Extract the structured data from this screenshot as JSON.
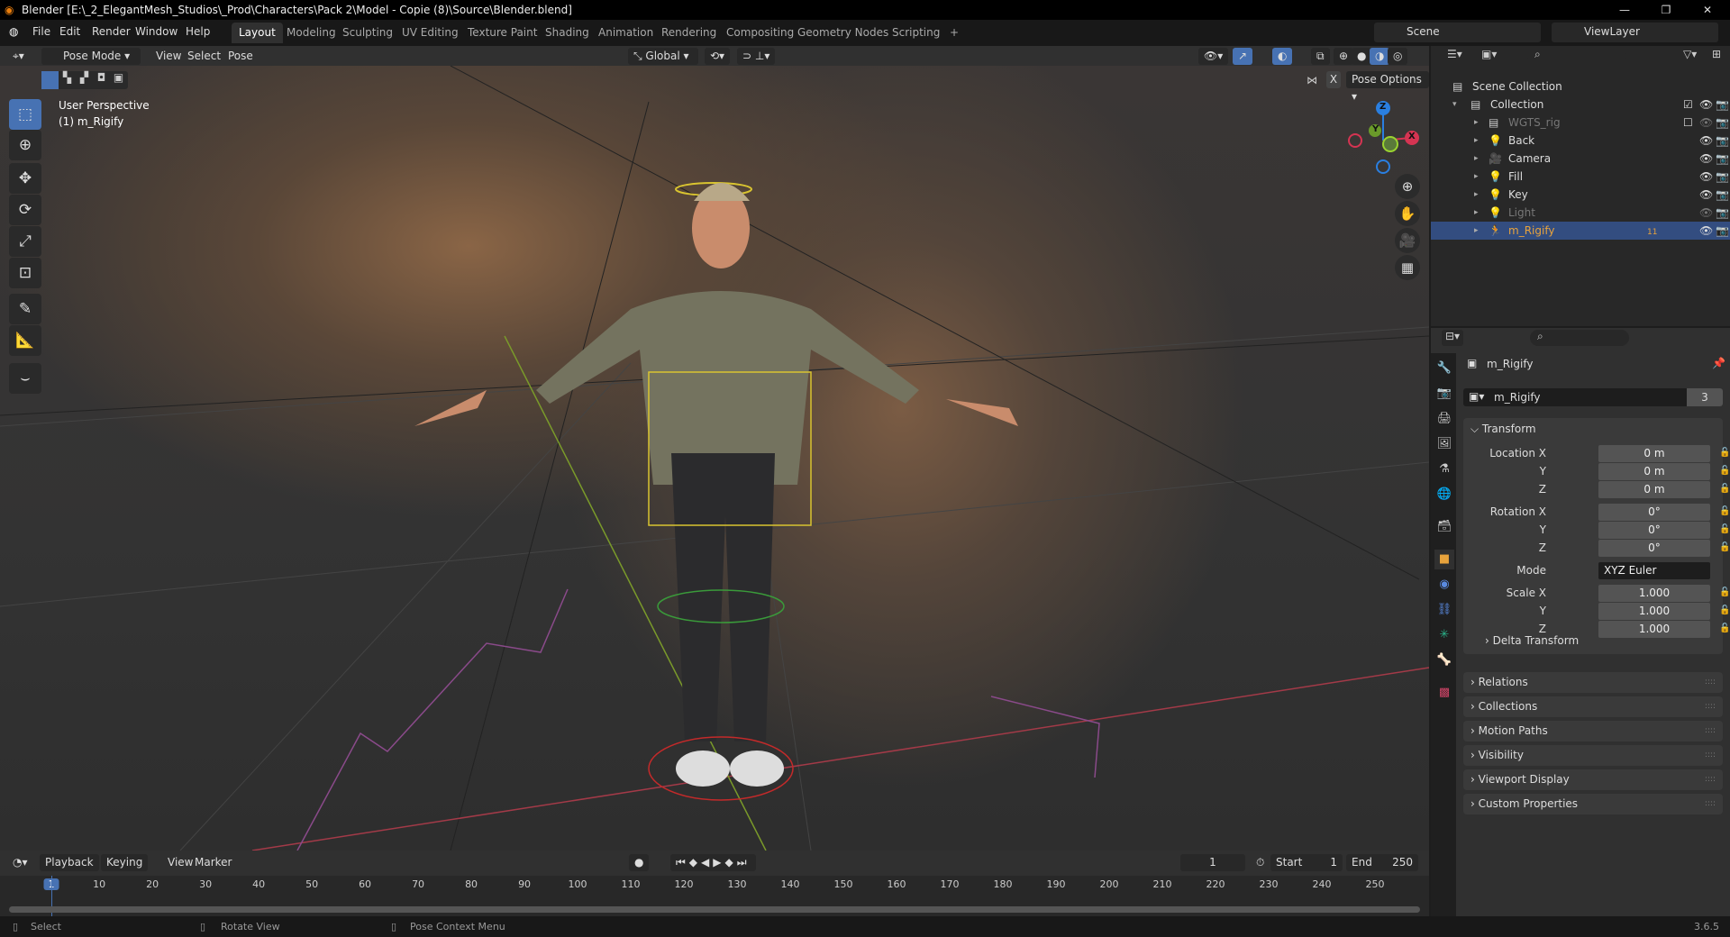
{
  "title": "Blender [E:\\_2_ElegantMesh_Studios\\_Prod\\Characters\\Pack 2\\Model - Copie (8)\\Source\\Blender.blend]",
  "menu": [
    "File",
    "Edit",
    "Render",
    "Window",
    "Help"
  ],
  "workspaces": [
    "Layout",
    "Modeling",
    "Sculpting",
    "UV Editing",
    "Texture Paint",
    "Shading",
    "Animation",
    "Rendering",
    "Compositing",
    "Geometry Nodes",
    "Scripting",
    "+"
  ],
  "scene": "Scene",
  "view_layer": "ViewLayer",
  "viewport": {
    "mode": "Pose Mode",
    "menus": [
      "View",
      "Select",
      "Pose"
    ],
    "orientation": "Global",
    "pose_options": "Pose Options",
    "mirror_x": "X",
    "overlay_title": "User Perspective",
    "overlay_object": "(1) m_Rigify",
    "gizmo": {
      "z": "Z",
      "y": "Y",
      "x": "X"
    }
  },
  "outliner": {
    "items": [
      {
        "name": "Scene Collection",
        "indent": 0,
        "icon": "collection"
      },
      {
        "name": "Collection",
        "indent": 1,
        "icon": "collection"
      },
      {
        "name": "WGTS_rig",
        "indent": 2,
        "icon": "collection",
        "dim": true
      },
      {
        "name": "Back",
        "indent": 2,
        "icon": "light"
      },
      {
        "name": "Camera",
        "indent": 2,
        "icon": "camera"
      },
      {
        "name": "Fill",
        "indent": 2,
        "icon": "light"
      },
      {
        "name": "Key",
        "indent": 2,
        "icon": "light"
      },
      {
        "name": "Light",
        "indent": 2,
        "icon": "light",
        "dim": true
      },
      {
        "name": "m_Rigify",
        "indent": 2,
        "icon": "armature",
        "selected": true
      }
    ],
    "badge": "11"
  },
  "properties": {
    "object_name": "m_Rigify",
    "data_name": "m_Rigify",
    "users": "3",
    "transform": "Transform",
    "rows": [
      {
        "label": "Location X",
        "value": "0 m"
      },
      {
        "label": "Y",
        "value": "0 m"
      },
      {
        "label": "Z",
        "value": "0 m"
      },
      {
        "label": "Rotation X",
        "value": "0°"
      },
      {
        "label": "Y",
        "value": "0°"
      },
      {
        "label": "Z",
        "value": "0°"
      },
      {
        "label": "Mode",
        "value": "XYZ Euler"
      },
      {
        "label": "Scale X",
        "value": "1.000"
      },
      {
        "label": "Y",
        "value": "1.000"
      },
      {
        "label": "Z",
        "value": "1.000"
      }
    ],
    "delta": "Delta Transform",
    "panels": [
      "Relations",
      "Collections",
      "Motion Paths",
      "Visibility",
      "Viewport Display",
      "Custom Properties"
    ]
  },
  "timeline": {
    "menus": [
      "Playback",
      "Keying",
      "View",
      "Marker"
    ],
    "current_frame": "1",
    "start_label": "Start",
    "start": "1",
    "end_label": "End",
    "end": "250",
    "ticks": [
      "1",
      "10",
      "20",
      "30",
      "40",
      "50",
      "60",
      "70",
      "80",
      "90",
      "100",
      "110",
      "120",
      "130",
      "140",
      "150",
      "160",
      "170",
      "180",
      "190",
      "200",
      "210",
      "220",
      "230",
      "240",
      "250"
    ]
  },
  "status": {
    "select": "Select",
    "rotate": "Rotate View",
    "context": "Pose Context Menu",
    "version": "3.6.5"
  },
  "colors": {
    "accent": "#4772b3",
    "selected_row": "#334d80",
    "object_orange": "#e8a33c"
  }
}
